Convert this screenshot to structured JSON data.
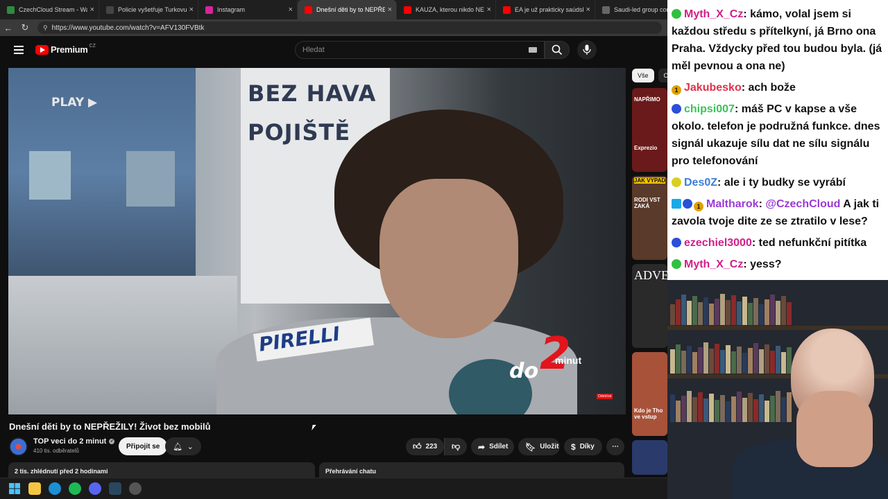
{
  "browser": {
    "tabs": [
      {
        "title": "CzechCloud Stream - Watch",
        "favicon": "twitch-icon",
        "color": "#2d8a3e",
        "active": false
      },
      {
        "title": "Policie vyšetřuje Turkovu neh",
        "favicon": "news-icon",
        "color": "#444444",
        "active": false
      },
      {
        "title": "Instagram",
        "favicon": "instagram-icon",
        "color": "#d6249f",
        "active": false
      },
      {
        "title": "Dnešní děti by to NEPŘEŽILY",
        "favicon": "youtube-icon",
        "color": "#ff0000",
        "active": true
      },
      {
        "title": "KAUZA, kterou nikdo NECHÁ",
        "favicon": "youtube-icon",
        "color": "#ff0000",
        "active": false
      },
      {
        "title": "EA je už prakticky saúdská. E",
        "favicon": "youtube-icon",
        "color": "#ff0000",
        "active": false
      },
      {
        "title": "Saudi-led group complet",
        "favicon": "news-icon",
        "color": "#666666",
        "active": false
      }
    ],
    "url": "https://www.youtube.com/watch?v=AFV130FVBtk"
  },
  "youtube": {
    "logo_text": "Premium",
    "logo_region": "CZ",
    "search_placeholder": "Hledat",
    "chips": [
      "Vše",
      "O"
    ],
    "video": {
      "overlay_play": "PLAY ▶",
      "sign_line1": "BEZ HAVA",
      "sign_line2": "POJIŠTĚ",
      "pirelli": "PIRELLI",
      "brand_do": "do",
      "brand_two": "2",
      "brand_minut": "minut",
      "corner_badge": "Odebírat"
    },
    "recs": [
      {
        "caption1": "NAPŘIMO",
        "caption2": "Exprezio",
        "color": "#6a1a1a"
      },
      {
        "caption1": "JAK VYPAD",
        "caption2": "RODI VST ZAKÁ",
        "color": "#5a3a2a"
      },
      {
        "caption1": "ADVE",
        "caption2": "",
        "color": "#2a2a2a"
      },
      {
        "caption1": "",
        "caption2": "Kdo je Tho ve vstup",
        "color": "#a8523a"
      }
    ],
    "title": "Dnešní děti by to NEPŘEŽILY! Život bez mobilů",
    "channel": {
      "name": "TOP veci do 2 minut",
      "subscribers": "410 tis. odběratelů"
    },
    "join_label": "Připojit se",
    "likes": "223",
    "share_label": "Sdílet",
    "save_label": "Uložit",
    "thanks_label": "Díky",
    "description_meta": "2 tis. zhlédnutí  před 2 hodinami",
    "chat_replay_label": "Přehrávání chatu"
  },
  "chat": {
    "messages": [
      {
        "badges": [
          "green"
        ],
        "user": "Myth_X_Cz",
        "user_color": "#d0208a",
        "text": ": kámo, volal jsem si každou středu s přítelkyní, já Brno ona Praha. Vždycky před tou budou byla. (já měl pevnou a ona ne)"
      },
      {
        "badges": [
          "num"
        ],
        "user": "Jakubesko",
        "user_color": "#e0304a",
        "text": ": ach bože"
      },
      {
        "badges": [
          "blue"
        ],
        "user": "chipsi007",
        "user_color": "#3cc25a",
        "text": ": máš PC v kapse a vše okolo. telefon je podružná funkce. dnes signál ukazuje sílu dat ne sílu signálu pro telefonování"
      },
      {
        "badges": [
          "yellow"
        ],
        "user": "Des0Z",
        "user_color": "#3a7fd9",
        "text": ": ale i ty budky se vyrábí"
      },
      {
        "badges": [
          "cube",
          "blue",
          "num"
        ],
        "user": "Maltharok",
        "user_color": "#9a3ad6",
        "text": ": @CzechCloud A jak ti zavola tvoje dite ze se ztratilo v lese?",
        "mention": "@CzechCloud"
      },
      {
        "badges": [
          "blue"
        ],
        "user": "ezechiel3000",
        "user_color": "#d0208a",
        "text": ": ted nefunkční pitítka"
      },
      {
        "badges": [
          "green"
        ],
        "user": "Myth_X_Cz",
        "user_color": "#d0208a",
        "text": ": yess?"
      }
    ],
    "badge_num": "1"
  }
}
